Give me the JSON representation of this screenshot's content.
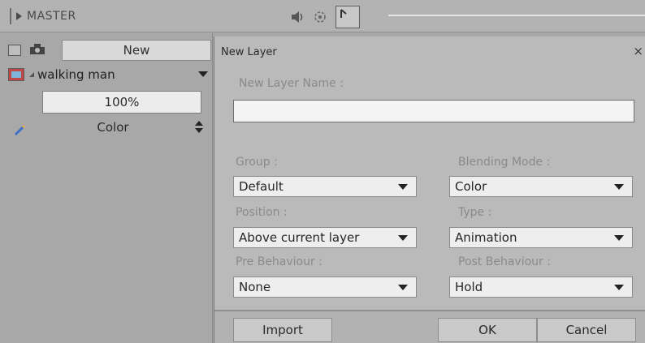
{
  "topbar": {
    "master_label": "MASTER",
    "icons": [
      "speaker-icon",
      "onion-skin-icon",
      "frame-box-icon"
    ]
  },
  "layers_panel": {
    "new_button": "New",
    "layer": {
      "name": "walking man",
      "opacity": "100%",
      "blend_mode": "Color"
    }
  },
  "dialog": {
    "title": "New Layer",
    "close_glyph": "×",
    "name_label": "New Layer Name :",
    "name_value": "",
    "group_label": "Group :",
    "group_value": "Default",
    "blending_label": "Blending Mode :",
    "blending_value": "Color",
    "position_label": "Position :",
    "position_value": "Above current layer",
    "type_label": "Type :",
    "type_value": "Animation",
    "pre_label": "Pre Behaviour :",
    "pre_value": "None",
    "post_label": "Post Behaviour :",
    "post_value": "Hold",
    "import_button": "Import",
    "ok_button": "OK",
    "cancel_button": "Cancel"
  },
  "colors": {
    "background": "#a7a7a7",
    "dialog_bg": "#bababa",
    "input_bg": "#eeeeee",
    "label_grey": "#8a8a8a"
  }
}
